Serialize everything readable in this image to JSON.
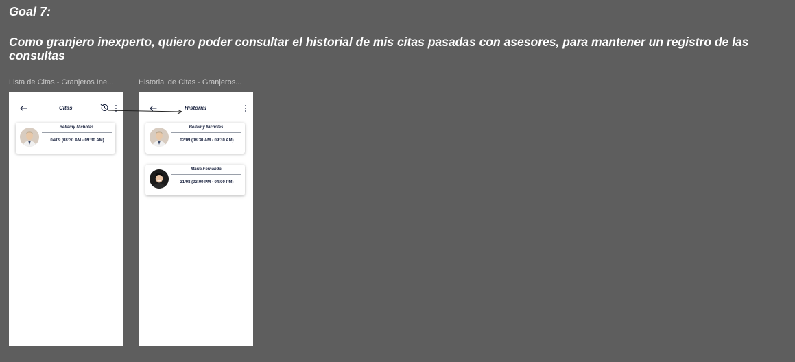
{
  "goal": {
    "title": "Goal 7:",
    "description": "Como granjero inexperto, quiero poder consultar el historial de mis citas pasadas con asesores, para mantener un registro de las consultas"
  },
  "frames": [
    {
      "label": "Lista de Citas - Granjeros Ine...",
      "screen_title": "Citas",
      "icons": [
        "back-arrow-icon",
        "history-icon",
        "more-vertical-icon"
      ],
      "cards": [
        {
          "name": "Bellamy Nicholas",
          "time": "04/09 (08:30 AM - 09:30 AM)"
        }
      ]
    },
    {
      "label": "Historial de Citas - Granjeros...",
      "screen_title": "Historial",
      "icons": [
        "back-arrow-icon",
        "more-vertical-icon"
      ],
      "cards": [
        {
          "name": "Bellamy Nicholas",
          "time": "02/09 (08:30 AM - 09:30 AM)"
        },
        {
          "name": "Maria Fernanda",
          "time": "31/08 (03:00 PM - 04:00 PM)"
        }
      ]
    }
  ],
  "colors": {
    "canvas": "#5e5e5e",
    "frame": "#ffffff",
    "text_dark": "#1b2440",
    "label_gray": "#c9c9c9"
  }
}
